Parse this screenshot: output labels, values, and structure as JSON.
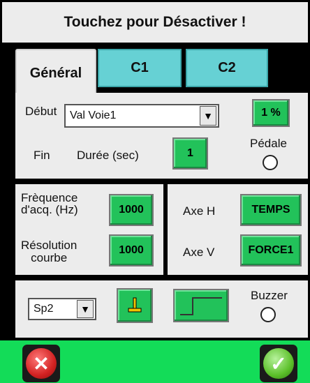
{
  "title": "Touchez pour Désactiver !",
  "tabs": [
    {
      "label": "Général",
      "active": true
    },
    {
      "label": "C1",
      "active": false
    },
    {
      "label": "C2",
      "active": false
    }
  ],
  "general": {
    "debut_label": "Début",
    "debut_value": "Val Voie1",
    "percent_value": "1 %",
    "fin_label": "Fin",
    "duree_label": "Durée (sec)",
    "duree_value": "1",
    "pedale_label": "Pédale"
  },
  "acquisition": {
    "freq_label_line1": "Frèquence",
    "freq_label_line2": "d'acq. (Hz)",
    "freq_value": "1000",
    "res_label_line1": "Résolution",
    "res_label_line2": "courbe",
    "res_value": "1000"
  },
  "axes": {
    "axe_h_label": "Axe H",
    "axe_h_value": "TEMPS",
    "axe_v_label": "Axe V",
    "axe_v_value": "FORCE1"
  },
  "bottom": {
    "sp_value": "Sp2",
    "buzzer_label": "Buzzer"
  },
  "colors": {
    "accent_green": "#22c25a",
    "tab_cyan": "#66d1d4",
    "footer_green": "#13dc58"
  },
  "icons": {
    "cancel": "close-icon",
    "confirm": "check-icon",
    "trigger_level": "level-marker-icon",
    "step": "step-signal-icon"
  }
}
